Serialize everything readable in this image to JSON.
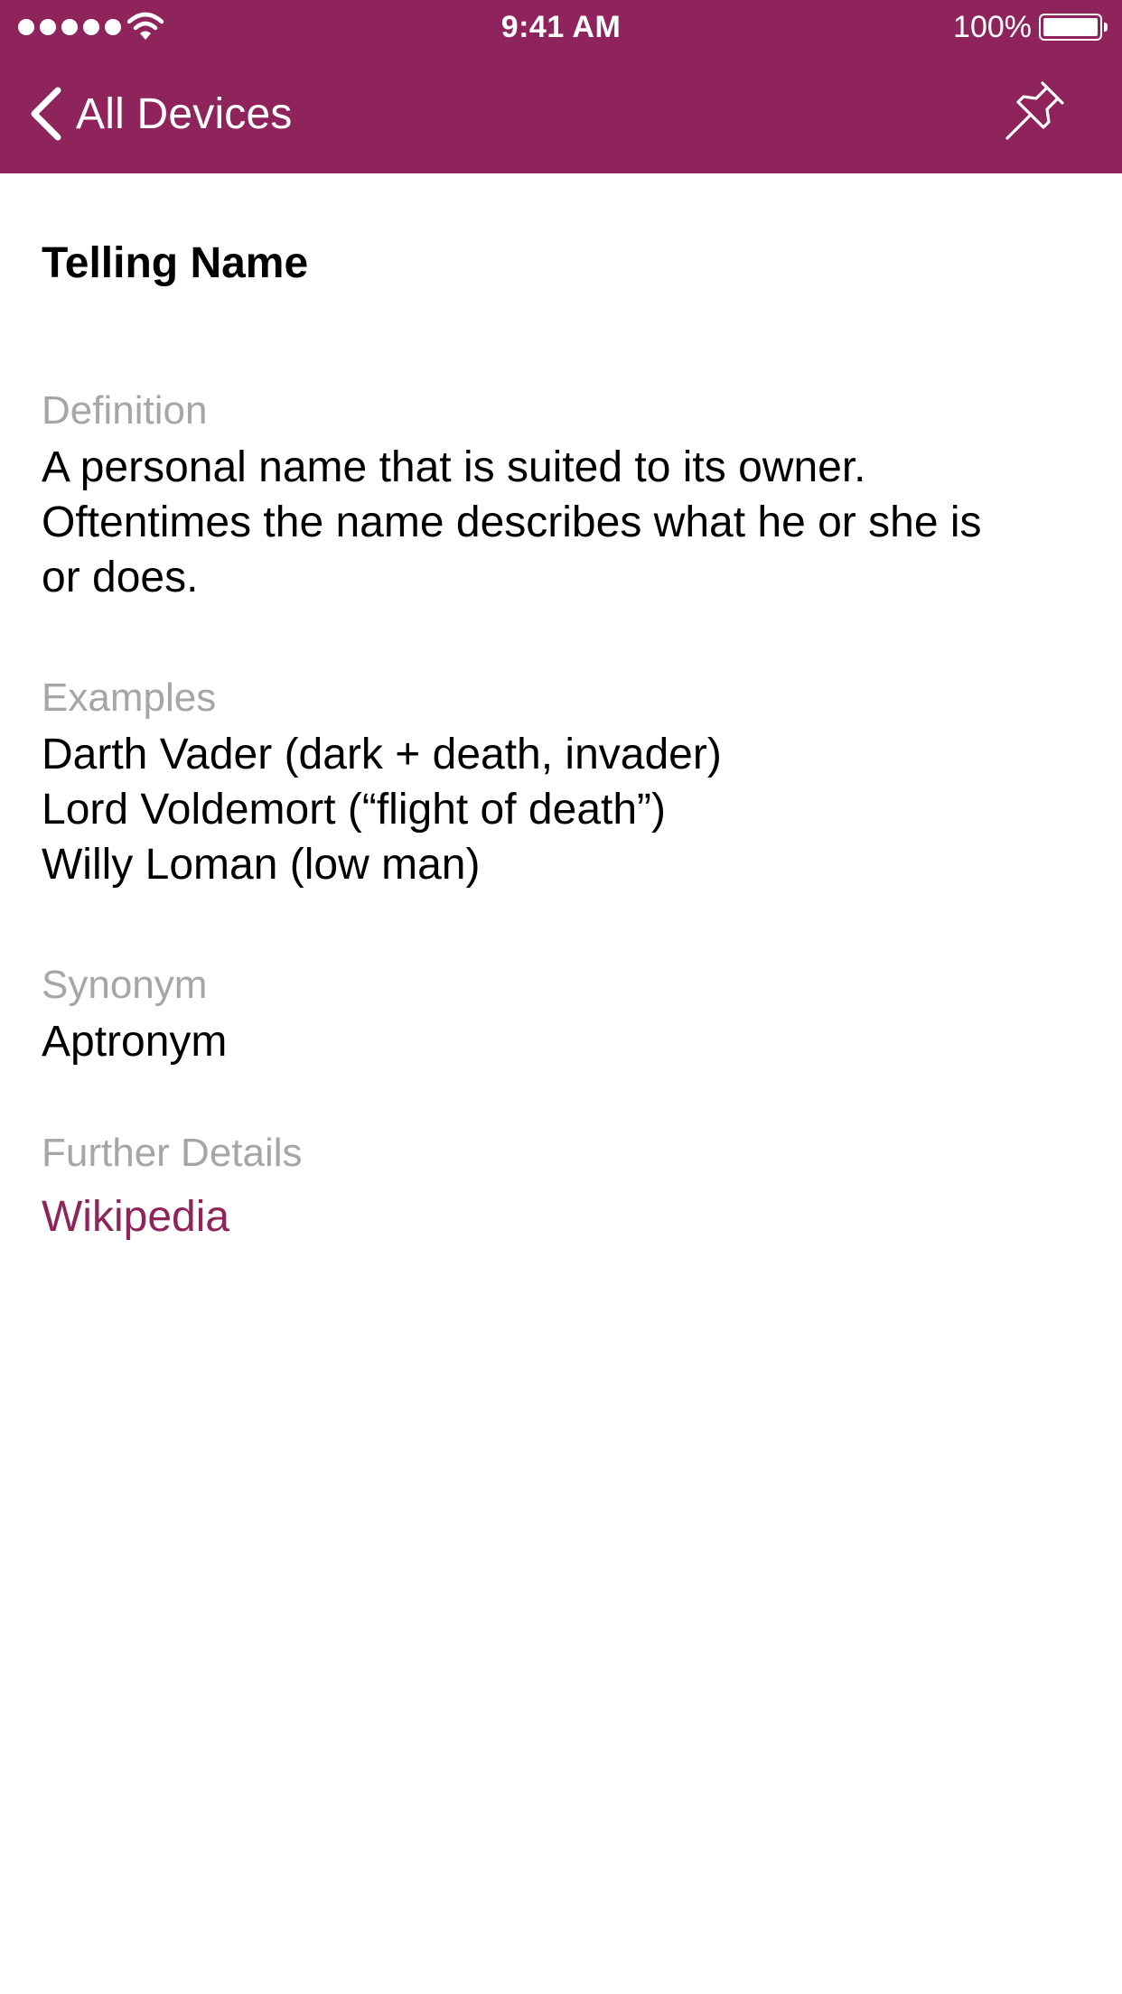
{
  "status_bar": {
    "time": "9:41 AM",
    "battery_percent": "100%",
    "signal_bars": 5
  },
  "nav": {
    "back_label": "All Devices",
    "back_icon": "chevron-left-icon",
    "pin_icon": "pin-icon"
  },
  "colors": {
    "accent": "#8f245c",
    "label_gray": "#a6a6a6",
    "text": "#000000",
    "background": "#ffffff"
  },
  "entry": {
    "title": "Telling Name",
    "definition": {
      "label": "Definition",
      "lines": [
        "A personal name that is suited to its owner.",
        "Oftentimes the name describes what he or she is",
        "or does."
      ]
    },
    "examples": {
      "label": "Examples",
      "items": [
        "Darth Vader (dark + death, invader)",
        "Lord Voldemort (“flight of death”)",
        "Willy Loman (low man)"
      ]
    },
    "synonym": {
      "label": "Synonym",
      "value": "Aptronym"
    },
    "further_details": {
      "label": "Further Details",
      "link": "Wikipedia"
    }
  }
}
